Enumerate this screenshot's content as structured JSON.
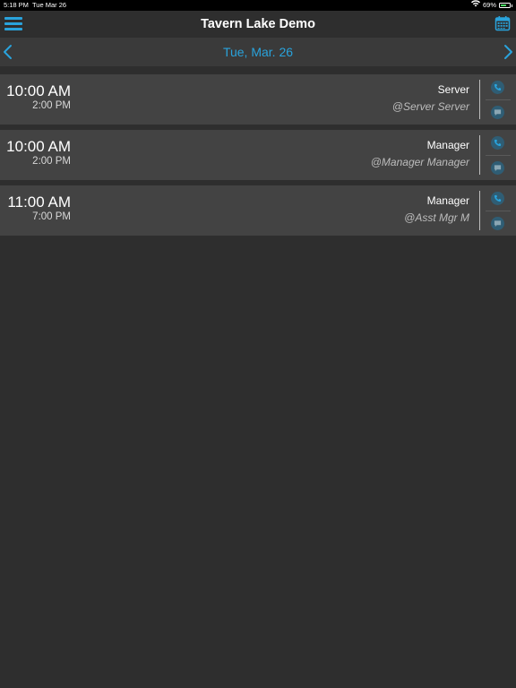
{
  "status_bar": {
    "time": "5:18 PM",
    "date": "Tue Mar 26",
    "battery": "69%",
    "battery_level": 0.69,
    "battery_color": "#4cd964"
  },
  "header": {
    "title": "Tavern Lake Demo",
    "menu_icon": "hamburger-menu-icon",
    "calendar_icon": "calendar-icon",
    "accent_color": "#29a3dc"
  },
  "date_nav": {
    "date": "Tue, Mar. 26",
    "prev_icon": "chevron-left-icon",
    "next_icon": "chevron-right-icon"
  },
  "shifts": [
    {
      "start": "10:00 AM",
      "end": "2:00 PM",
      "role": "Server",
      "employee": "@Server Server"
    },
    {
      "start": "10:00 AM",
      "end": "2:00 PM",
      "role": "Manager",
      "employee": "@Manager Manager"
    },
    {
      "start": "11:00 AM",
      "end": "7:00 PM",
      "role": "Manager",
      "employee": "@Asst Mgr M"
    }
  ],
  "shift_actions": {
    "call_icon": "phone-icon",
    "message_icon": "message-icon"
  }
}
